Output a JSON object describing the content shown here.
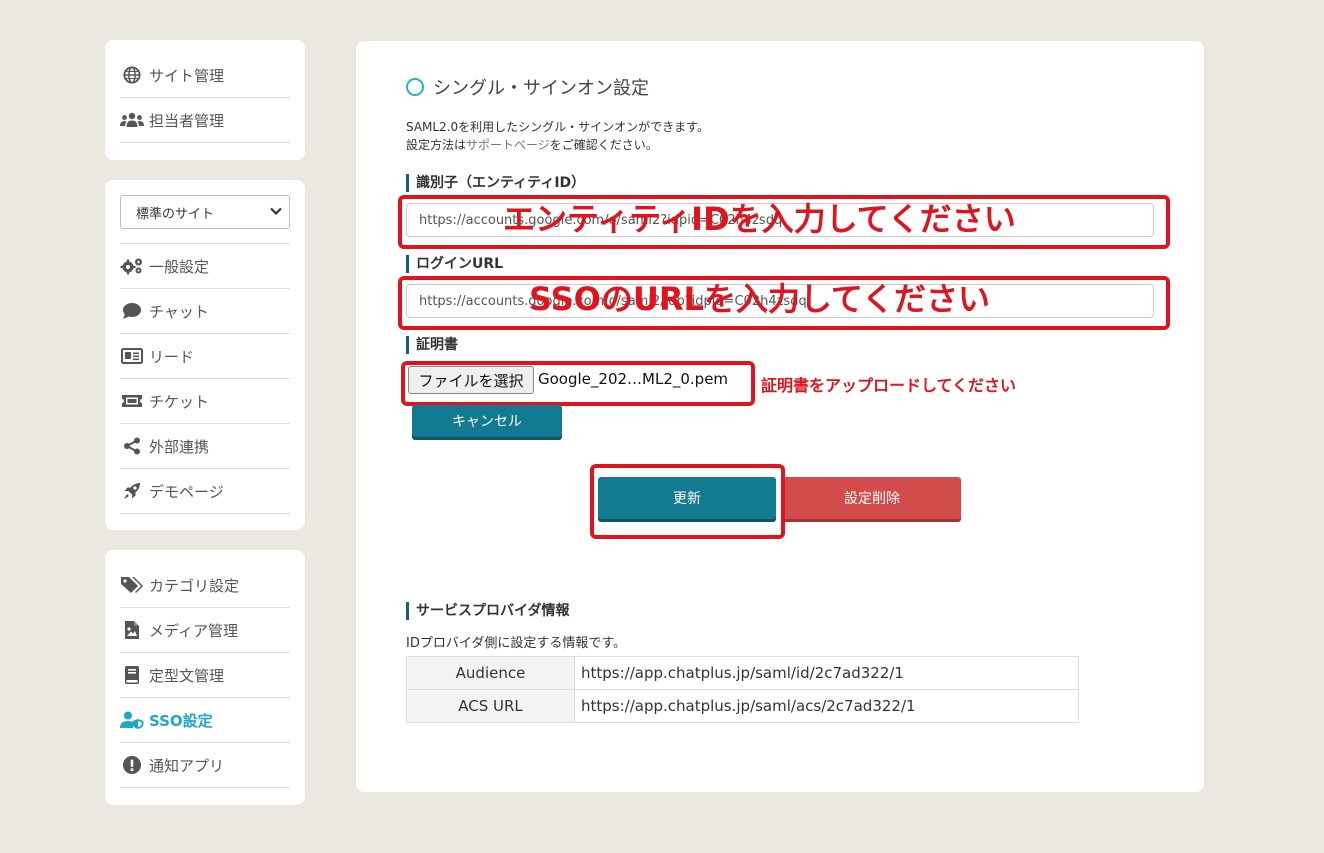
{
  "sidebar": {
    "top_items": [
      {
        "label": "サイト管理",
        "icon": "globe-icon"
      },
      {
        "label": "担当者管理",
        "icon": "users-icon"
      }
    ],
    "site_select": "標準のサイト",
    "site_items": [
      {
        "label": "一般設定",
        "icon": "gears-icon"
      },
      {
        "label": "チャット",
        "icon": "chat-bubble-icon"
      },
      {
        "label": "リード",
        "icon": "id-card-icon"
      },
      {
        "label": "チケット",
        "icon": "ticket-icon"
      },
      {
        "label": "外部連携",
        "icon": "share-icon"
      },
      {
        "label": "デモページ",
        "icon": "rocket-icon"
      }
    ],
    "bottom_items": [
      {
        "label": "カテゴリ設定",
        "icon": "tags-icon"
      },
      {
        "label": "メディア管理",
        "icon": "image-file-icon"
      },
      {
        "label": "定型文管理",
        "icon": "book-icon"
      },
      {
        "label": "SSO設定",
        "icon": "user-shield-icon",
        "active": true
      },
      {
        "label": "通知アプリ",
        "icon": "exclamation-icon"
      }
    ]
  },
  "main": {
    "title": "シングル・サインオン設定",
    "desc_line1": "SAML2.0を利用したシングル・サインオンができます。",
    "desc_line2_pre": "設定方法は",
    "desc_line2_link": "サポートページ",
    "desc_line2_post": "をご確認ください。",
    "entity_label": "識別子（エンティティID）",
    "entity_value": "https://accounts.google.com/o/saml2?idpid=C02h4zsdq",
    "entity_overlay": "エンティティIDを入力してください",
    "login_label": "ログインURL",
    "login_value": "https://accounts.google.com/o/saml2/idp?idpid=C02h4zsdq",
    "login_overlay": "SSOのURLを入力してください",
    "cert_label": "証明書",
    "file_button": "ファイルを選択",
    "file_name": "Google_202…ML2_0.pem",
    "cert_overlay": "証明書をアップロードしてください",
    "cancel_button": "キャンセル",
    "update_button": "更新",
    "delete_button": "設定削除",
    "sp_label": "サービスプロバイダ情報",
    "sp_desc": "IDプロバイダ側に設定する情報です。",
    "sp_rows": [
      {
        "key": "Audience",
        "value": "https://app.chatplus.jp/saml/id/2c7ad322/1"
      },
      {
        "key": "ACS URL",
        "value": "https://app.chatplus.jp/saml/acs/2c7ad322/1"
      }
    ]
  },
  "colors": {
    "accent": "#1fa7c9",
    "primary_button": "#127a91",
    "danger_button": "#d24c4c",
    "annotation_red": "#e0141e"
  }
}
